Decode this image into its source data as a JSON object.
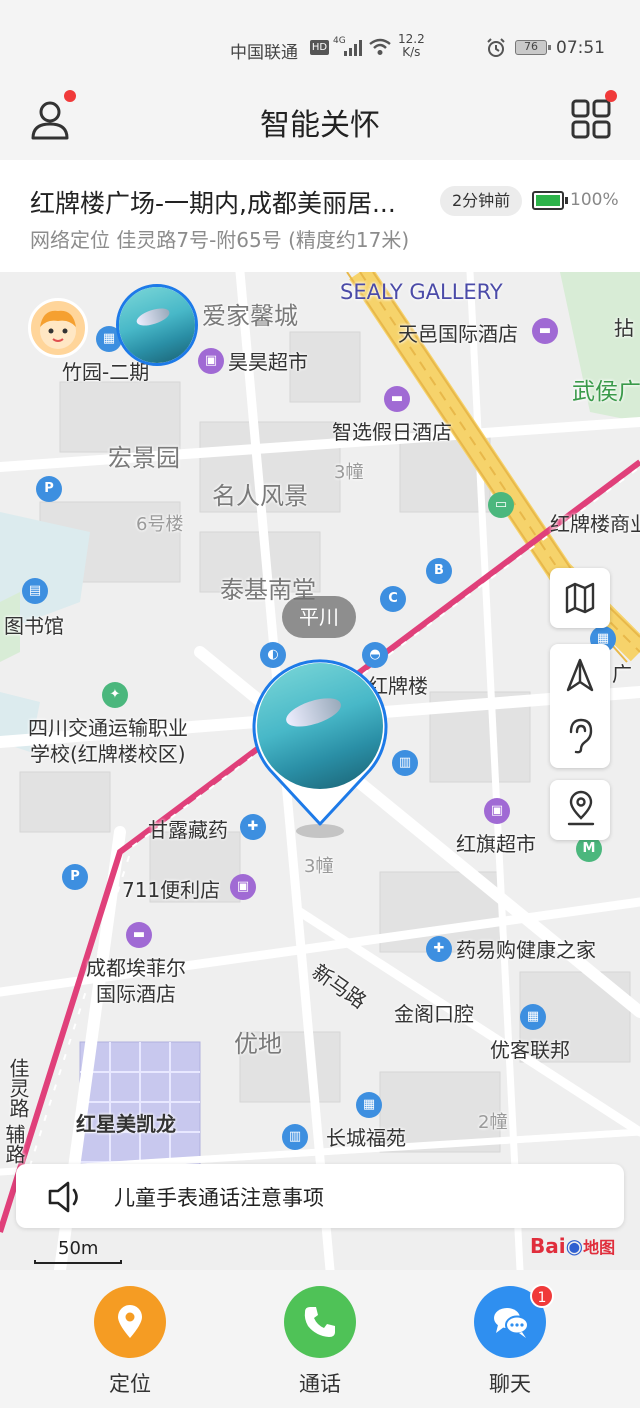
{
  "status_bar": {
    "carrier": "中国联通",
    "hd": "HD",
    "network": "4G",
    "speed_value": "12.2",
    "speed_unit": "K/s",
    "battery": "76",
    "time": "07:51"
  },
  "header": {
    "title": "智能关怀"
  },
  "location_card": {
    "address": "红牌楼广场-一期内,成都美丽居...",
    "time_ago": "2分钟前",
    "battery_percent": "100%",
    "detail": "网络定位  佳灵路7号-附65号  (精度约17米)"
  },
  "map": {
    "labels": {
      "aijia": "爱家馨城",
      "sealy": "SEALY GALLERY",
      "tianyi": "天邑国际酒店",
      "zhuyuan": "竹园-二期",
      "haohao": "昊昊超市",
      "wuhou": "武侯广",
      "zhixuan": "智选假日酒店",
      "hongjing": "宏景园",
      "mingren": "名人风景",
      "building3a": "3幢",
      "building6": "6号楼",
      "hongpailou_shang": "红牌楼商业",
      "taiji": "泰基南堂",
      "library": "图书馆",
      "hongpailou": "红牌楼",
      "sichuan_school_1": "四川交通运输职业",
      "sichuan_school_2": "学校(红牌楼校区)",
      "ganlu": "甘露藏药",
      "building3b": "3幢",
      "hongqi": "红旗超市",
      "store711": "711便利店",
      "chengdu_hotel_1": "成都埃菲尔",
      "chengdu_hotel_2": "国际酒店",
      "yaoyigou": "药易购健康之家",
      "xinmalu": "新马路",
      "jinge": "金阁口腔",
      "youdi": "优地",
      "youke": "优客联邦",
      "jialing_1": "佳灵路",
      "jialing_2": "辅路",
      "hongxing": "红星美凯龙",
      "changcheng": "长城福苑",
      "building2": "2幢",
      "scale": "50m",
      "baidu_brand": "Bai",
      "baidu_map": "地图"
    },
    "device_chip": "平川",
    "notice": "儿童手表通话注意事项"
  },
  "bottom_bar": {
    "locate_label": "定位",
    "call_label": "通话",
    "chat_label": "聊天",
    "chat_badge": "1"
  },
  "colors": {
    "accent_orange": "#f59c23",
    "accent_green": "#4fc257",
    "accent_blue": "#2f8ff0",
    "pin_blue": "#1d7ae8",
    "metro_line": "#e0407a",
    "expressway": "#f6d36b"
  }
}
